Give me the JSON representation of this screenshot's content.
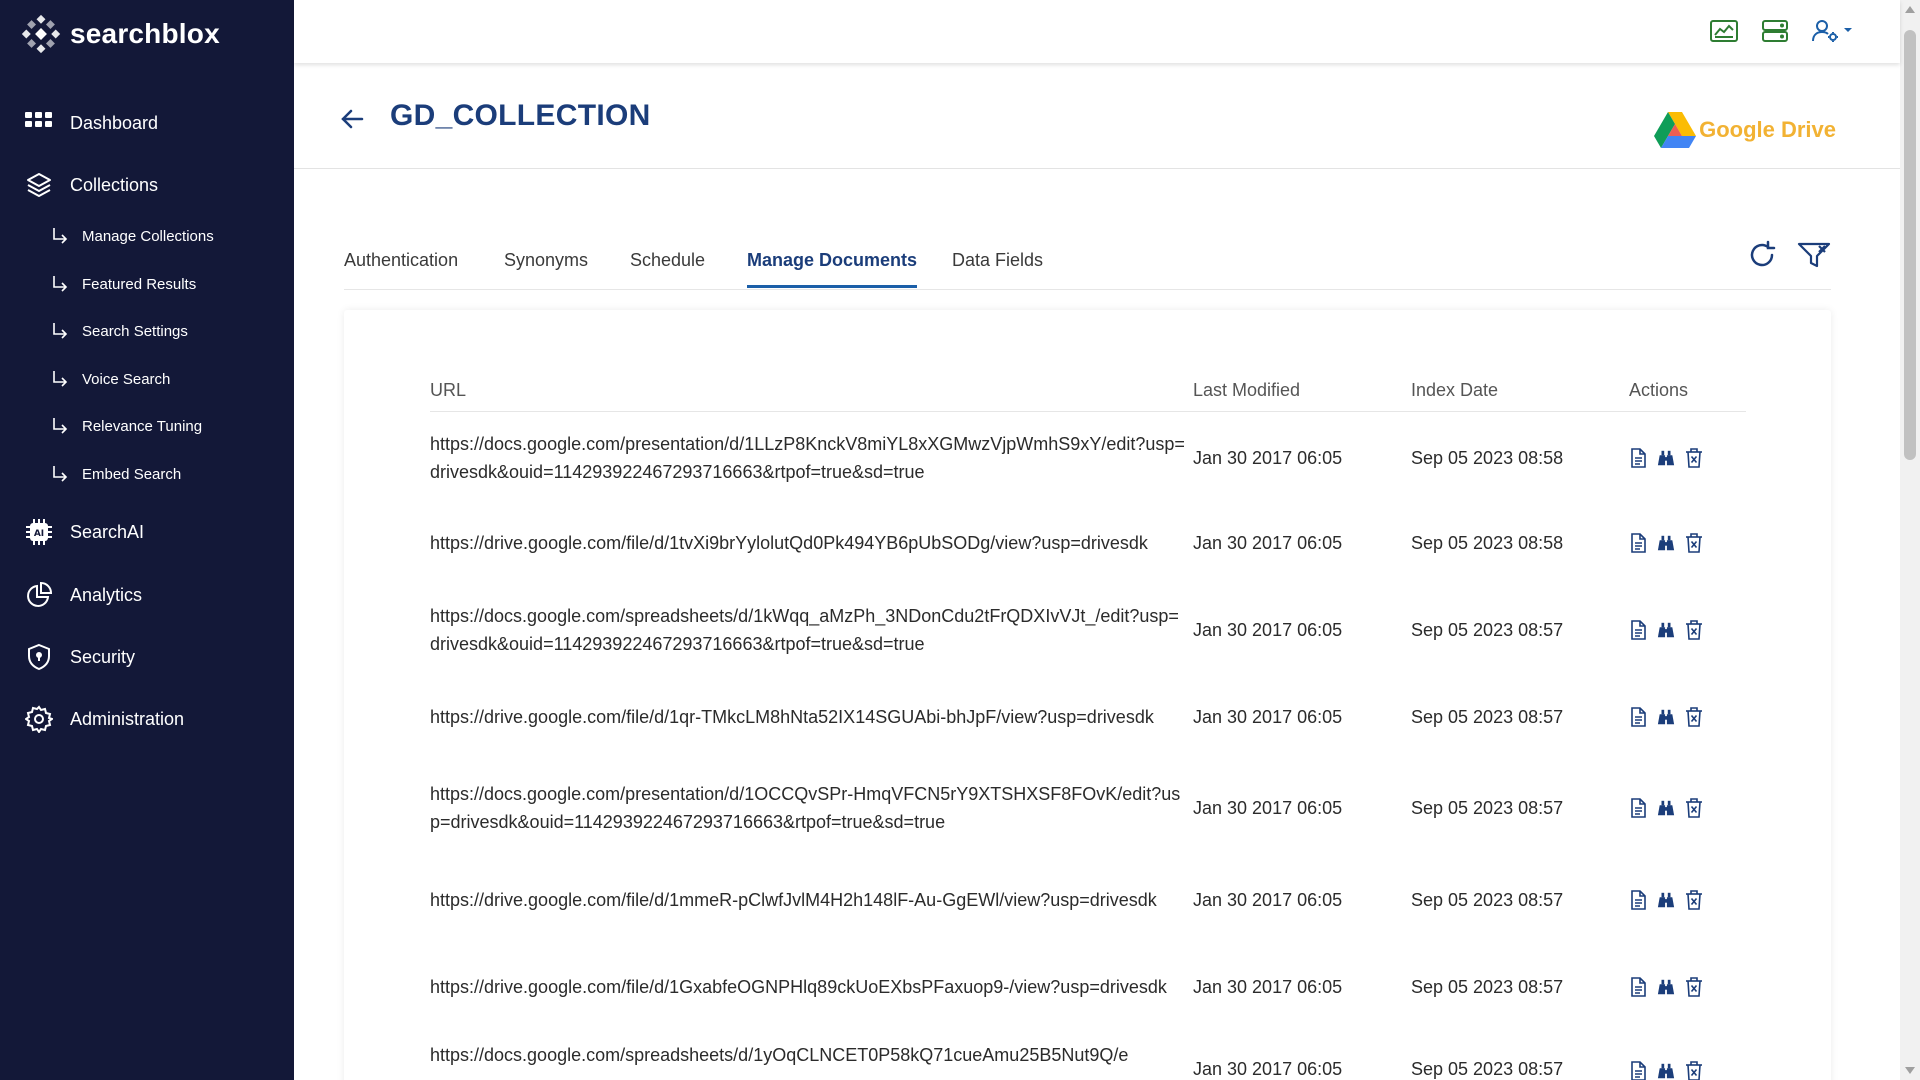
{
  "brand": {
    "name": "searchblox"
  },
  "sidebar": {
    "main": [
      {
        "label": "Dashboard",
        "icon": "dashboard-grid-icon"
      },
      {
        "label": "Collections",
        "icon": "layers-icon"
      },
      {
        "label": "SearchAI",
        "icon": "ai-chip-icon"
      },
      {
        "label": "Analytics",
        "icon": "pie-chart-icon"
      },
      {
        "label": "Security",
        "icon": "shield-icon"
      },
      {
        "label": "Administration",
        "icon": "gear-icon"
      }
    ],
    "sub": [
      {
        "label": "Manage Collections"
      },
      {
        "label": "Featured Results"
      },
      {
        "label": "Search Settings"
      },
      {
        "label": "Voice Search"
      },
      {
        "label": "Relevance Tuning"
      },
      {
        "label": "Embed Search"
      }
    ]
  },
  "topbar": {
    "icons": [
      "monitor-chart-icon",
      "server-stack-icon",
      "user-settings-icon"
    ]
  },
  "header": {
    "title": "GD_COLLECTION",
    "connector": "Google Drive"
  },
  "tabs": [
    {
      "label": "Authentication"
    },
    {
      "label": "Synonyms"
    },
    {
      "label": "Schedule"
    },
    {
      "label": "Manage Documents",
      "active": true
    },
    {
      "label": "Data Fields"
    }
  ],
  "table": {
    "columns": {
      "url": "URL",
      "modified": "Last Modified",
      "index": "Index Date",
      "actions": "Actions"
    },
    "rows": [
      {
        "url": "https://docs.google.com/presentation/d/1LLzP8KnckV8miYL8xXGMwzVjpWmhS9xY/edit?usp=drivesdk&ouid=114293922467293716663&rtpof=true&sd=true",
        "modified": "Jan 30 2017 06:05",
        "index": "Sep 05 2023 08:58"
      },
      {
        "url": "https://drive.google.com/file/d/1tvXi9brYylolutQd0Pk494YB6pUbSODg/view?usp=drivesdk",
        "modified": "Jan 30 2017 06:05",
        "index": "Sep 05 2023 08:58"
      },
      {
        "url": "https://docs.google.com/spreadsheets/d/1kWqq_aMzPh_3NDonCdu2tFrQDXIvVJt_/edit?usp=drivesdk&ouid=114293922467293716663&rtpof=true&sd=true",
        "modified": "Jan 30 2017 06:05",
        "index": "Sep 05 2023 08:57"
      },
      {
        "url": "https://drive.google.com/file/d/1qr-TMkcLM8hNta52IX14SGUAbi-bhJpF/view?usp=drivesdk",
        "modified": "Jan 30 2017 06:05",
        "index": "Sep 05 2023 08:57"
      },
      {
        "url": "https://docs.google.com/presentation/d/1OCCQvSPr-HmqVFCN5rY9XTSHXSF8FOvK/edit?usp=drivesdk&ouid=114293922467293716663&rtpof=true&sd=true",
        "modified": "Jan 30 2017 06:05",
        "index": "Sep 05 2023 08:57"
      },
      {
        "url": "https://drive.google.com/file/d/1mmeR-pClwfJvlM4H2h148lF-Au-GgEWl/view?usp=drivesdk",
        "modified": "Jan 30 2017 06:05",
        "index": "Sep 05 2023 08:57"
      },
      {
        "url": "https://drive.google.com/file/d/1GxabfeOGNPHlq89ckUoEXbsPFaxuop9-/view?usp=drivesdk",
        "modified": "Jan 30 2017 06:05",
        "index": "Sep 05 2023 08:57"
      },
      {
        "url": "https://docs.google.com/spreadsheets/d/1yOqCLNCET0P58kQ71cueAmu25B5Nut9Q/e",
        "modified": "Jan 30 2017 06:05",
        "index": "Sep 05 2023 08:57"
      }
    ],
    "action_icons": [
      "document-icon",
      "binoculars-icon",
      "trash-icon"
    ]
  },
  "colors": {
    "sidebar_bg": "#131838",
    "title": "#1b3d7a",
    "tab_active": "#1b5fa8",
    "icon_blue": "#1b3d7a",
    "topbar_green": "#2e7d32"
  }
}
